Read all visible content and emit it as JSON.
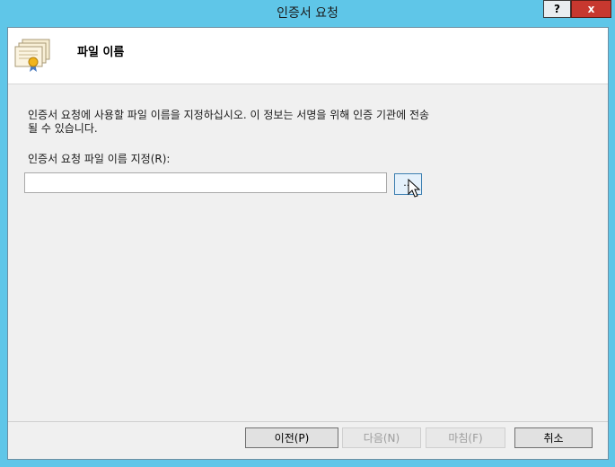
{
  "window": {
    "title": "인증서 요청",
    "help_label": "?",
    "close_label": "x"
  },
  "header": {
    "title": "파일 이름",
    "icon": "certificate-icon"
  },
  "body": {
    "description_line1": "인증서 요청에 사용할 파일 이름을 지정하십시오. 이 정보는 서명을 위해 인증 기관에 전송",
    "description_line2": "될 수 있습니다.",
    "field_label": "인증서 요청 파일 이름 지정(R):",
    "file_value": "",
    "browse_label": "..."
  },
  "footer": {
    "prev_label": "이전(P)",
    "next_label": "다음(N)",
    "finish_label": "마침(F)",
    "cancel_label": "취소"
  }
}
